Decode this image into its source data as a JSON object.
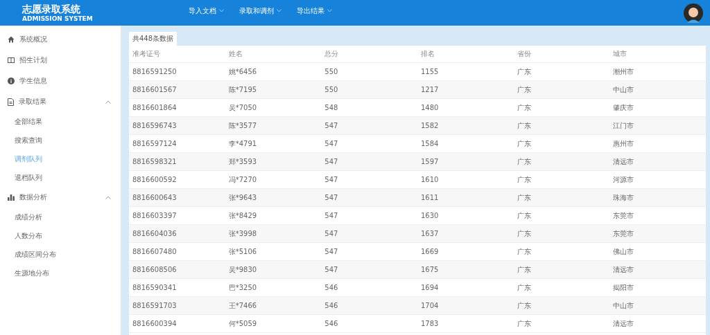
{
  "header": {
    "title": "志愿录取系统",
    "subtitle": "ADMISSION SYSTEM",
    "nav": [
      {
        "label": "导入文档"
      },
      {
        "label": "录取和调剂"
      },
      {
        "label": "导出结果"
      }
    ]
  },
  "sidebar": {
    "items": [
      {
        "label": "系统概况",
        "selected": false
      },
      {
        "label": "招生计划",
        "selected": false
      },
      {
        "label": "学生信息",
        "selected": false
      },
      {
        "label": "录取结果",
        "selected": false,
        "expanded": true,
        "children": [
          {
            "label": "全部结果",
            "selected": false
          },
          {
            "label": "搜索查询",
            "selected": false
          },
          {
            "label": "调剂队列",
            "selected": true
          },
          {
            "label": "退档队列",
            "selected": false
          }
        ]
      },
      {
        "label": "数据分析",
        "selected": false,
        "expanded": true,
        "children": [
          {
            "label": "成绩分析",
            "selected": false
          },
          {
            "label": "人数分布",
            "selected": false
          },
          {
            "label": "成绩区间分布",
            "selected": false
          },
          {
            "label": "生源地分布",
            "selected": false
          }
        ]
      }
    ]
  },
  "tab": {
    "label": "共448条数据"
  },
  "table": {
    "columns": [
      "准考证号",
      "姓名",
      "总分",
      "排名",
      "省份",
      "城市"
    ],
    "rows": [
      [
        "8816591250",
        "姚*6456",
        "550",
        "1155",
        "广东",
        "潮州市"
      ],
      [
        "8816601567",
        "陈*7195",
        "550",
        "1217",
        "广东",
        "中山市"
      ],
      [
        "8816601864",
        "吴*7050",
        "548",
        "1480",
        "广东",
        "肇庆市"
      ],
      [
        "8816596743",
        "陈*3577",
        "547",
        "1582",
        "广东",
        "江门市"
      ],
      [
        "8816597124",
        "李*4791",
        "547",
        "1584",
        "广东",
        "惠州市"
      ],
      [
        "8816598321",
        "郑*3593",
        "547",
        "1597",
        "广东",
        "清远市"
      ],
      [
        "8816600592",
        "冯*7270",
        "547",
        "1610",
        "广东",
        "河源市"
      ],
      [
        "8816600643",
        "张*9643",
        "547",
        "1611",
        "广东",
        "珠海市"
      ],
      [
        "8816603397",
        "张*8429",
        "547",
        "1630",
        "广东",
        "东莞市"
      ],
      [
        "8816604036",
        "张*3998",
        "547",
        "1637",
        "广东",
        "东莞市"
      ],
      [
        "8816607480",
        "张*5106",
        "547",
        "1669",
        "广东",
        "佛山市"
      ],
      [
        "8816608506",
        "吴*9830",
        "547",
        "1675",
        "广东",
        "清远市"
      ],
      [
        "8816590341",
        "巴*3250",
        "546",
        "1694",
        "广东",
        "揭阳市"
      ],
      [
        "8816591703",
        "王*7466",
        "546",
        "1704",
        "广东",
        "中山市"
      ],
      [
        "8816600394",
        "何*5059",
        "546",
        "1783",
        "广东",
        "清远市"
      ]
    ]
  }
}
